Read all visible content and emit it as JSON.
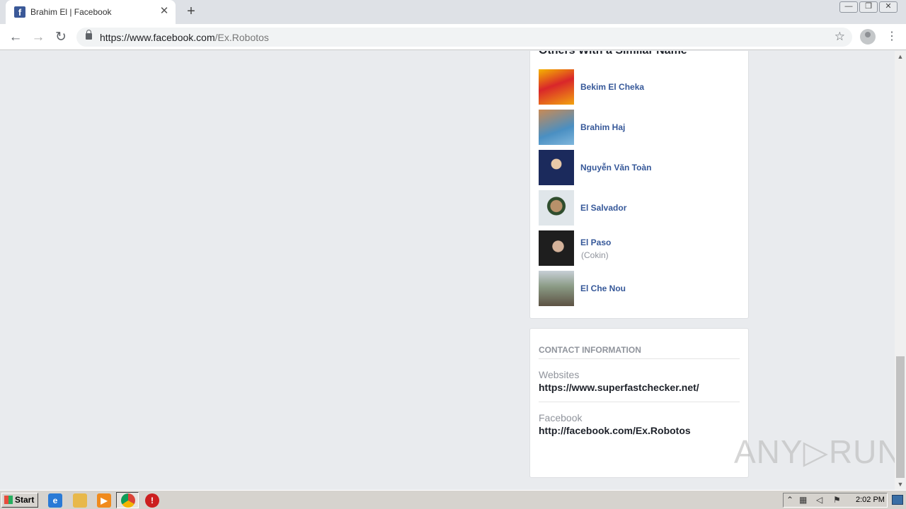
{
  "browser": {
    "tab_title": "Brahim El | Facebook",
    "tab_close": "✕",
    "new_tab": "+",
    "url_host": "https://www.facebook.com",
    "url_path": "/Ex.Robotos",
    "back": "←",
    "forward": "→",
    "reload": "↻",
    "star": "☆",
    "menu": "⋮",
    "win_minimize": "—",
    "win_restore": "❐",
    "win_close": "✕"
  },
  "similar": {
    "title": "Others With a Similar Name",
    "people": [
      {
        "name": "Bekim El Cheka",
        "sub": "",
        "color": "#d9262a"
      },
      {
        "name": "Brahim Haj",
        "sub": "",
        "color": "#4a8fc2"
      },
      {
        "name": "Nguyễn Văn Toàn",
        "sub": "",
        "color": "#1b2a5c"
      },
      {
        "name": "El Salvador",
        "sub": "",
        "color": "#6f8f6a"
      },
      {
        "name": "El Paso",
        "sub": "(Cokin)",
        "color": "#2a2a2a"
      },
      {
        "name": "El Che Nou",
        "sub": "",
        "color": "#7b8a76"
      }
    ]
  },
  "contact": {
    "heading": "CONTACT INFORMATION",
    "websites_label": "Websites",
    "websites_value": "https://www.superfastchecker.net/",
    "facebook_label": "Facebook",
    "facebook_value": "http://facebook.com/Ex.Robotos"
  },
  "watermark": "ANY▷RUN",
  "taskbar": {
    "start": "Start",
    "clock": "2:02 PM"
  }
}
